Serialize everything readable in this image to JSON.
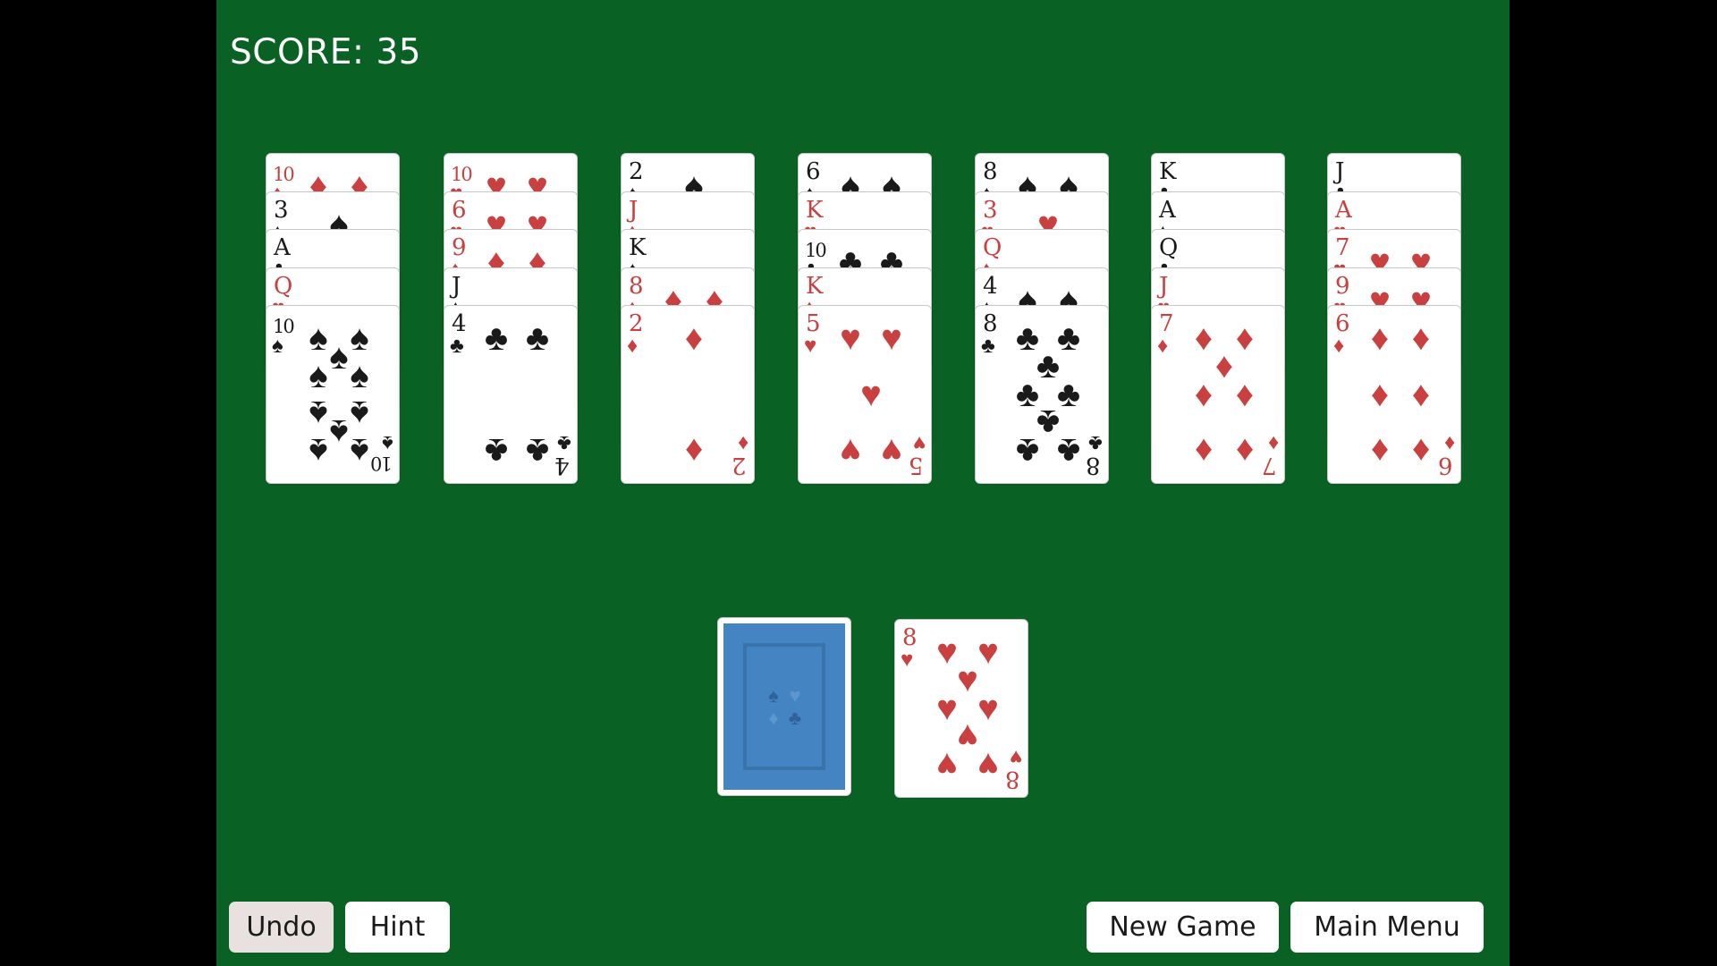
{
  "score": {
    "label": "SCORE: 35",
    "value": 35
  },
  "colors": {
    "felt": "#0a6124",
    "red_suit": "#c94040",
    "black_suit": "#1a1a1a",
    "card_back": "#4584c2"
  },
  "tableau": [
    {
      "cards": [
        {
          "rank": "10",
          "suit": "diamonds"
        },
        {
          "rank": "3",
          "suit": "spades"
        },
        {
          "rank": "A",
          "suit": "clubs"
        },
        {
          "rank": "Q",
          "suit": "hearts"
        },
        {
          "rank": "10",
          "suit": "spades"
        }
      ]
    },
    {
      "cards": [
        {
          "rank": "10",
          "suit": "hearts"
        },
        {
          "rank": "6",
          "suit": "hearts"
        },
        {
          "rank": "9",
          "suit": "diamonds"
        },
        {
          "rank": "J",
          "suit": "spades"
        },
        {
          "rank": "4",
          "suit": "clubs"
        }
      ]
    },
    {
      "cards": [
        {
          "rank": "2",
          "suit": "spades"
        },
        {
          "rank": "J",
          "suit": "diamonds"
        },
        {
          "rank": "K",
          "suit": "spades"
        },
        {
          "rank": "8",
          "suit": "diamonds"
        },
        {
          "rank": "2",
          "suit": "diamonds"
        }
      ]
    },
    {
      "cards": [
        {
          "rank": "6",
          "suit": "spades"
        },
        {
          "rank": "K",
          "suit": "hearts"
        },
        {
          "rank": "10",
          "suit": "clubs"
        },
        {
          "rank": "K",
          "suit": "diamonds"
        },
        {
          "rank": "5",
          "suit": "hearts"
        }
      ]
    },
    {
      "cards": [
        {
          "rank": "8",
          "suit": "spades"
        },
        {
          "rank": "3",
          "suit": "hearts"
        },
        {
          "rank": "Q",
          "suit": "diamonds"
        },
        {
          "rank": "4",
          "suit": "spades"
        },
        {
          "rank": "8",
          "suit": "clubs"
        }
      ]
    },
    {
      "cards": [
        {
          "rank": "K",
          "suit": "clubs"
        },
        {
          "rank": "A",
          "suit": "spades"
        },
        {
          "rank": "Q",
          "suit": "clubs"
        },
        {
          "rank": "J",
          "suit": "hearts"
        },
        {
          "rank": "7",
          "suit": "diamonds"
        }
      ]
    },
    {
      "cards": [
        {
          "rank": "J",
          "suit": "clubs"
        },
        {
          "rank": "A",
          "suit": "hearts"
        },
        {
          "rank": "7",
          "suit": "hearts"
        },
        {
          "rank": "9",
          "suit": "hearts"
        },
        {
          "rank": "6",
          "suit": "diamonds"
        }
      ]
    }
  ],
  "stock": {
    "face_down": true,
    "icon": "card-back-suits-icon"
  },
  "waste": {
    "rank": "8",
    "suit": "hearts"
  },
  "buttons": {
    "undo": "Undo",
    "hint": "Hint",
    "new_game": "New Game",
    "main_menu": "Main Menu"
  }
}
